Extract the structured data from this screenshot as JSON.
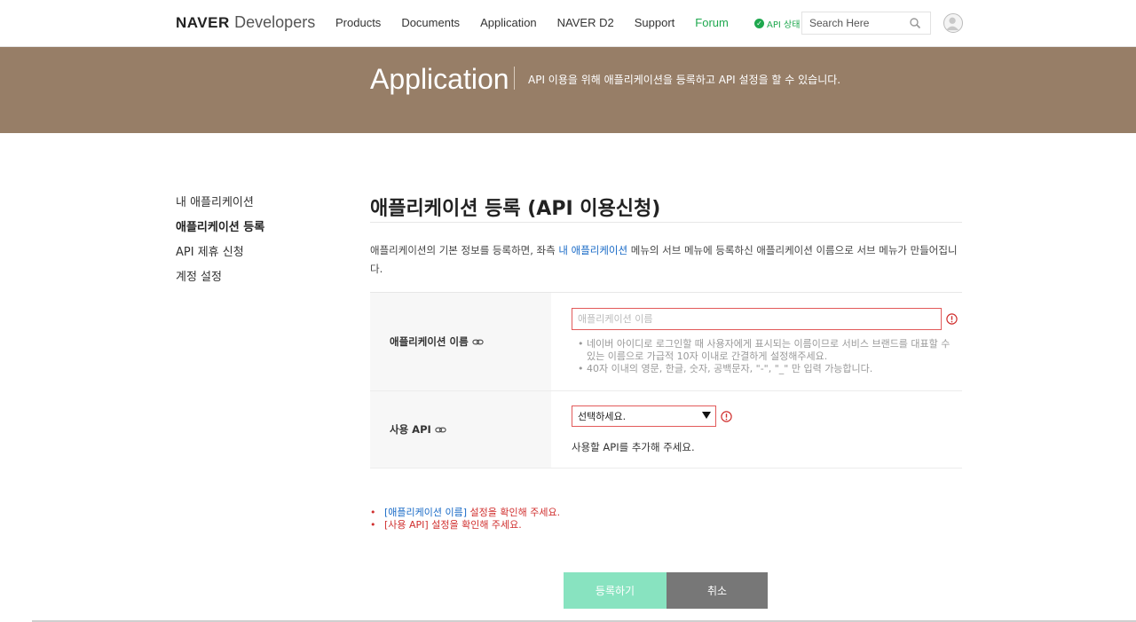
{
  "header": {
    "logo_brand": "NAVER",
    "logo_product": "Developers",
    "nav": [
      "Products",
      "Documents",
      "Application",
      "NAVER D2",
      "Support",
      "Forum"
    ],
    "api_status": "API 상태",
    "search_placeholder": "Search Here",
    "accent_color": "#1ea84e"
  },
  "banner": {
    "title": "Application",
    "description": "API 이용을 위해 애플리케이션을 등록하고 API 설정을 할 수 있습니다.",
    "background_color": "#977e67"
  },
  "sidebar": {
    "items": [
      {
        "label": "내 애플리케이션"
      },
      {
        "label": "애플리케이션 등록"
      },
      {
        "label": "API 제휴 신청"
      },
      {
        "label": "계정 설정"
      }
    ]
  },
  "main": {
    "title": "애플리케이션 등록 (API 이용신청)",
    "intro_before": "애플리케이션의 기본 정보를 등록하면, 좌측 ",
    "intro_link": "내 애플리케이션",
    "intro_after": " 메뉴의 서브 메뉴에 등록하신 애플리케이션 이름으로 서브 메뉴가 만들어집니다.",
    "form": {
      "app_name_label": "애플리케이션 이름",
      "app_name_placeholder": "애플리케이션 이름",
      "app_name_value": "",
      "hints": [
        "네이버 아이디로 로그인할 때 사용자에게 표시되는 이름이므로 서비스 브랜드를 대표할 수 있는 이름으로 가급적 10자 이내로 간결하게 설정해주세요.",
        "40자 이내의 영문, 한글, 숫자, 공백문자, \"-\", \"_\" 만 입력 가능합니다."
      ],
      "api_label": "사용 API",
      "api_select_value": "선택하세요.",
      "api_help": "사용할 API를 추가해 주세요."
    },
    "errors": [
      {
        "field": "[애플리케이션 이름]",
        "message": " 설정을 확인해 주세요."
      },
      {
        "field": "",
        "message": "[사용 API] 설정을 확인해 주세요."
      }
    ],
    "buttons": {
      "register": "등록하기",
      "cancel": "취소"
    },
    "error_color": "#d0302f",
    "link_color": "#1a6bc7"
  }
}
